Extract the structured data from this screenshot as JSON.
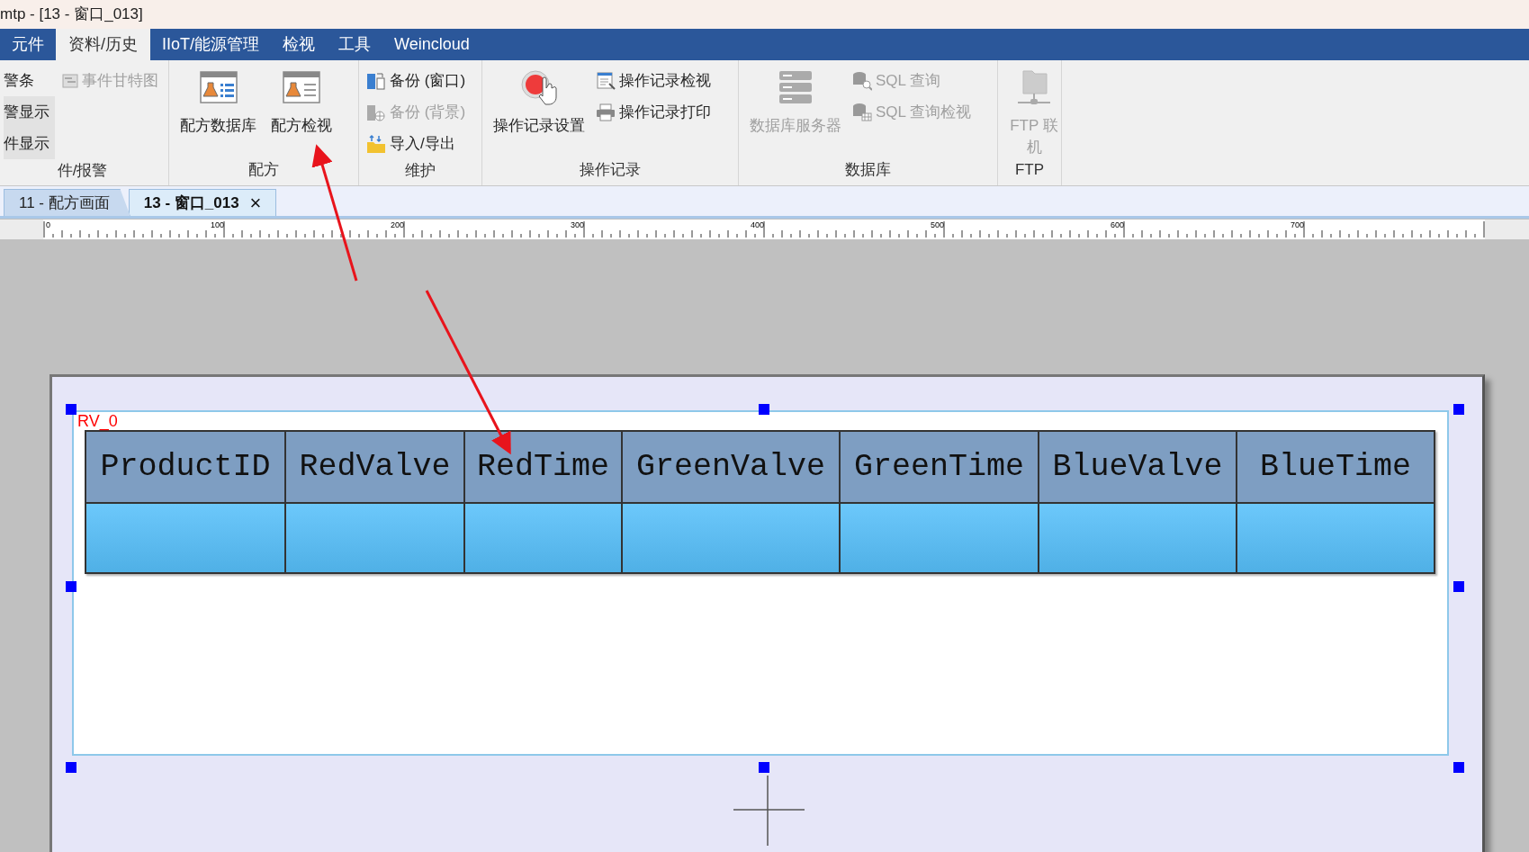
{
  "window": {
    "title": "mtp - [13 - 窗口_013]"
  },
  "menu": [
    {
      "label": "元件",
      "selected": false
    },
    {
      "label": "资料/历史",
      "selected": true
    },
    {
      "label": "IIoT/能源管理",
      "selected": false
    },
    {
      "label": "检视",
      "selected": false
    },
    {
      "label": "工具",
      "selected": false
    },
    {
      "label": "Weincloud",
      "selected": false
    }
  ],
  "ribbon": {
    "groups": [
      {
        "label": "件/报警",
        "items": [
          {
            "label": "警条",
            "kind": "small",
            "disabled": false,
            "highlighted": false
          },
          {
            "label": "警显示",
            "kind": "small",
            "disabled": false,
            "highlighted": true
          },
          {
            "label": "件显示",
            "kind": "small",
            "disabled": false,
            "highlighted": true
          },
          {
            "label": "事件甘特图",
            "kind": "small",
            "disabled": true,
            "highlighted": false
          }
        ]
      },
      {
        "label": "配方",
        "items": [
          {
            "label": "配方数据库",
            "kind": "large",
            "disabled": false,
            "highlighted": false
          },
          {
            "label": "配方检视",
            "kind": "large",
            "disabled": false,
            "highlighted": false
          }
        ]
      },
      {
        "label": "维护",
        "items": [
          {
            "label": "备份 (窗口)",
            "kind": "small",
            "disabled": false,
            "highlighted": false
          },
          {
            "label": "备份 (背景)",
            "kind": "small",
            "disabled": true,
            "highlighted": false
          },
          {
            "label": "导入/导出",
            "kind": "small",
            "disabled": false,
            "highlighted": false
          }
        ]
      },
      {
        "label": "操作记录",
        "items": [
          {
            "label": "操作记录设置",
            "kind": "large",
            "disabled": false,
            "highlighted": false
          },
          {
            "label": "操作记录检视",
            "kind": "small",
            "disabled": false,
            "highlighted": false
          },
          {
            "label": "操作记录打印",
            "kind": "small",
            "disabled": false,
            "highlighted": false
          }
        ]
      },
      {
        "label": "数据库",
        "items": [
          {
            "label": "数据库服务器",
            "kind": "large",
            "disabled": true,
            "highlighted": false
          },
          {
            "label": "SQL 查询",
            "kind": "small",
            "disabled": true,
            "highlighted": false
          },
          {
            "label": "SQL 查询检视",
            "kind": "small",
            "disabled": true,
            "highlighted": false
          }
        ]
      },
      {
        "label": "FTP",
        "items": [
          {
            "label": "FTP 联机",
            "kind": "large",
            "disabled": true,
            "highlighted": false
          }
        ]
      }
    ]
  },
  "document_tabs": [
    {
      "label": "11 - 配方画面",
      "selected": false,
      "closable": false
    },
    {
      "label": "13 - 窗口_013",
      "selected": true,
      "closable": true
    }
  ],
  "close_glyph": "×",
  "ruler": {
    "labels": [
      "0",
      "100",
      "200",
      "300",
      "400",
      "500",
      "600",
      "700"
    ]
  },
  "recipe_view": {
    "name": "RV_0",
    "columns": [
      "ProductID",
      "RedValve",
      "RedTime",
      "GreenValve",
      "GreenTime",
      "BlueValve",
      "BlueTime"
    ]
  }
}
